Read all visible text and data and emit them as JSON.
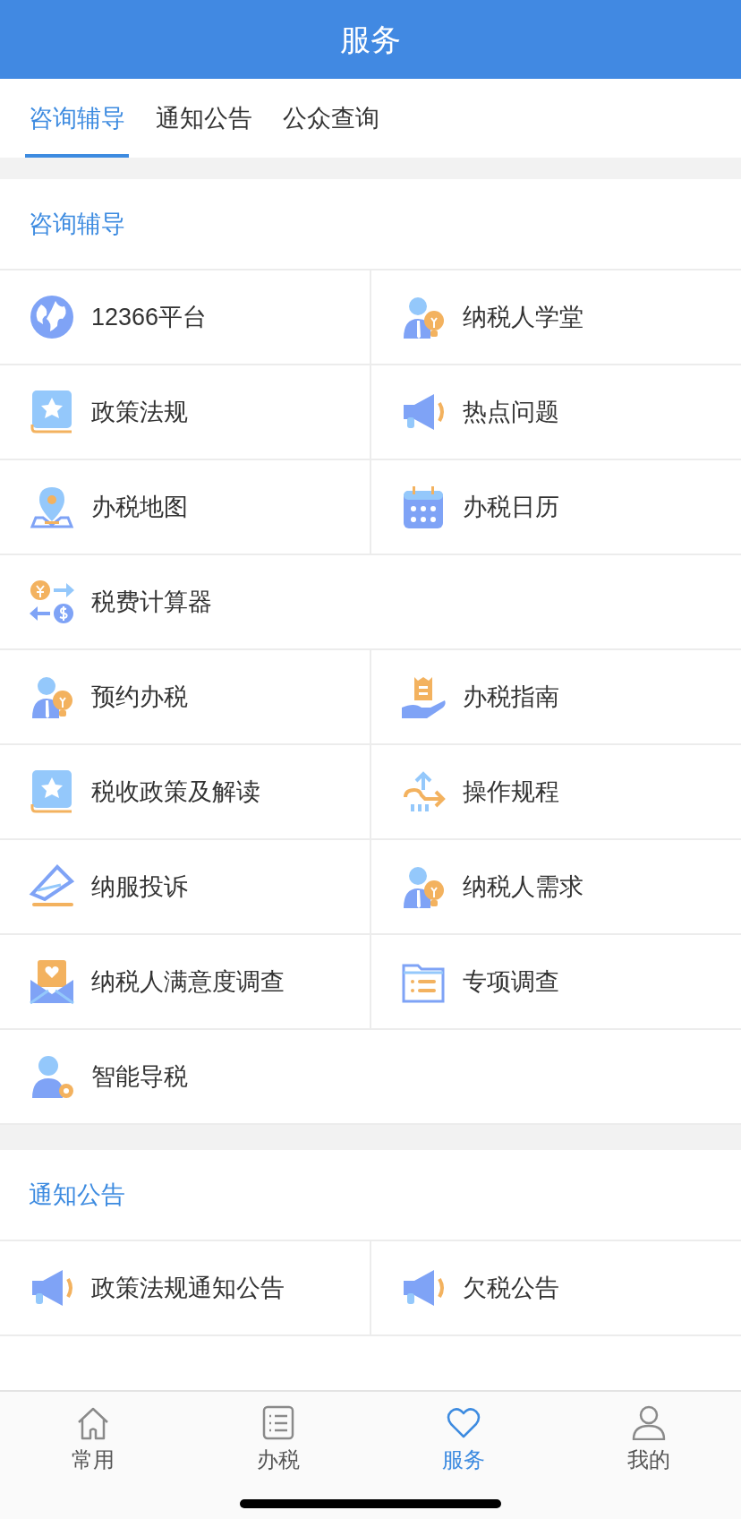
{
  "header": {
    "title": "服务"
  },
  "tabs": [
    {
      "label": "咨询辅导",
      "selected": true
    },
    {
      "label": "通知公告",
      "selected": false
    },
    {
      "label": "公众查询",
      "selected": false
    }
  ],
  "sections": [
    {
      "title": "咨询辅导",
      "rows": [
        [
          {
            "label": "12366平台"
          },
          {
            "label": "纳税人学堂"
          }
        ],
        [
          {
            "label": "政策法规"
          },
          {
            "label": "热点问题"
          }
        ],
        [
          {
            "label": "办税地图"
          },
          {
            "label": "办税日历"
          }
        ],
        [
          {
            "label": "税费计算器"
          }
        ],
        [
          {
            "label": "预约办税"
          },
          {
            "label": "办税指南"
          }
        ],
        [
          {
            "label": "税收政策及解读"
          },
          {
            "label": "操作规程"
          }
        ],
        [
          {
            "label": "纳服投诉"
          },
          {
            "label": "纳税人需求"
          }
        ],
        [
          {
            "label": "纳税人满意度调查"
          },
          {
            "label": "专项调查"
          }
        ],
        [
          {
            "label": "智能导税"
          }
        ]
      ]
    },
    {
      "title": "通知公告",
      "rows": [
        [
          {
            "label": "政策法规通知公告"
          },
          {
            "label": "欠税公告"
          }
        ]
      ]
    }
  ],
  "nav": [
    {
      "label": "常用",
      "selected": false
    },
    {
      "label": "办税",
      "selected": false
    },
    {
      "label": "服务",
      "selected": true
    },
    {
      "label": "我的",
      "selected": false
    }
  ]
}
